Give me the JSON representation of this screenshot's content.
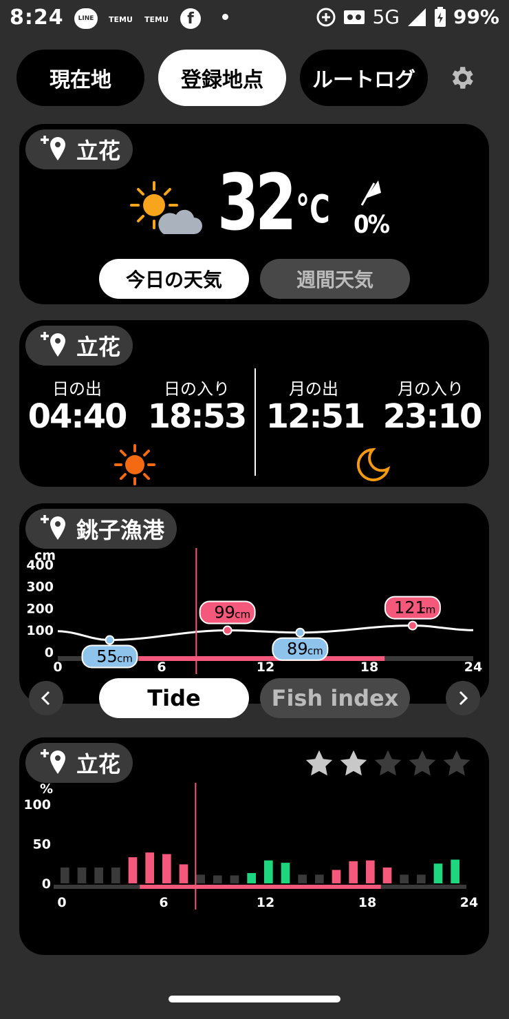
{
  "status_bar": {
    "time": "8:24",
    "notif_line": "LINE",
    "notif_temu1": "TEMU",
    "notif_temu2": "TEMU",
    "network": "5G",
    "battery": "99%"
  },
  "top_tabs": {
    "current": "現在地",
    "registered": "登録地点",
    "route_log": "ルートログ",
    "active": "registered"
  },
  "weather_card": {
    "location": "立花",
    "temperature": "32",
    "unit": "°C",
    "rain_chance": "0%",
    "today_btn": "今日の天気",
    "weekly_btn": "週間天気"
  },
  "sun_moon_card": {
    "location": "立花",
    "sunrise_label": "日の出",
    "sunrise": "04:40",
    "sunset_label": "日の入り",
    "sunset": "18:53",
    "moonrise_label": "月の出",
    "moonrise": "12:51",
    "moonset_label": "月の入り",
    "moonset": "23:10"
  },
  "tide_card": {
    "location": "銚子漁港",
    "unit": "cm",
    "tab_tide": "Tide",
    "tab_fish": "Fish index",
    "high_color": "#f4587a",
    "low_color": "#8ec3ec",
    "chart_data": {
      "type": "line",
      "xlim": [
        0,
        24
      ],
      "ylim": [
        0,
        400
      ],
      "yticks": [
        "400",
        "300",
        "200",
        "100",
        "0"
      ],
      "xticks": [
        "0",
        "6",
        "12",
        "18",
        "24"
      ],
      "ylabel": "cm",
      "current_hour": 8,
      "daylight": [
        4.67,
        18.88
      ],
      "extremes": [
        {
          "hour": 3,
          "value": 55,
          "kind": "low",
          "label": "55",
          "unit": "cm"
        },
        {
          "hour": 9.8,
          "value": 99,
          "kind": "high",
          "label": "99",
          "unit": "cm"
        },
        {
          "hour": 14,
          "value": 89,
          "kind": "low",
          "label": "89",
          "unit": "cm"
        },
        {
          "hour": 20.5,
          "value": 121,
          "kind": "high",
          "label": "121",
          "unit": "cm"
        }
      ]
    }
  },
  "fish_card": {
    "location": "立花",
    "rating": 2,
    "rating_max": 5,
    "colors": {
      "low": "#3a3a3a",
      "mid": "#f4587a",
      "high": "#1ed67e"
    },
    "chart_data": {
      "type": "bar",
      "ylabel": "%",
      "yticks": [
        "100",
        "50",
        "0"
      ],
      "xticks": [
        "0",
        "6",
        "12",
        "18",
        "24"
      ],
      "ylim": [
        0,
        100
      ],
      "current_hour": 8,
      "daylight": [
        4.67,
        18.88
      ],
      "values": [
        20,
        20,
        20,
        20,
        33,
        39,
        37,
        24,
        11,
        10,
        10,
        13,
        29,
        26,
        11,
        11,
        17,
        28,
        29,
        20,
        11,
        11,
        25,
        30
      ],
      "levels": [
        "low",
        "low",
        "low",
        "low",
        "mid",
        "mid",
        "mid",
        "mid",
        "low",
        "low",
        "low",
        "high",
        "high",
        "high",
        "low",
        "low",
        "mid",
        "mid",
        "mid",
        "mid",
        "low",
        "low",
        "high",
        "high"
      ]
    }
  }
}
